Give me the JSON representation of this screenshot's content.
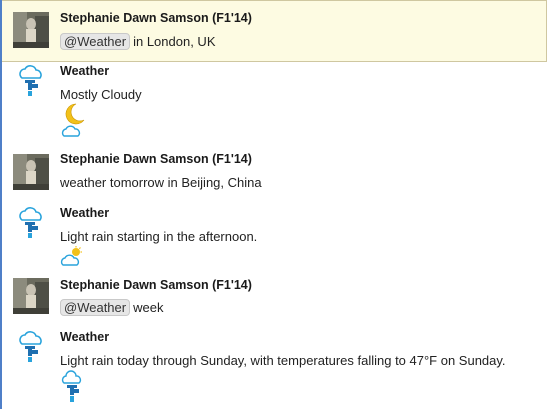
{
  "messages": [
    {
      "author": "Stephanie Dawn Samson (F1'14)",
      "mention": "@Weather",
      "text": "in London, UK"
    },
    {
      "author": "Weather",
      "text": "Mostly Cloudy",
      "icon": "moon-cloud-icon"
    },
    {
      "author": "Stephanie Dawn Samson (F1'14)",
      "text": "weather tomorrow in Beijing, China"
    },
    {
      "author": "Weather",
      "text": "Light rain starting in the afternoon.",
      "icon": "sun-cloud-icon"
    },
    {
      "author": "Stephanie Dawn Samson (F1'14)",
      "mention": "@Weather",
      "text": "week"
    },
    {
      "author": "Weather",
      "text": "Light rain today through Sunday, with temperatures falling to 47°F on Sunday.",
      "icon": "rain-cloud-icon"
    }
  ],
  "colors": {
    "highlight_bg": "#fdfbe2",
    "rail": "#4f7fc8",
    "cloud": "#29a3dc",
    "faucet": "#1f6fb0",
    "moon": "#f2c11a"
  }
}
